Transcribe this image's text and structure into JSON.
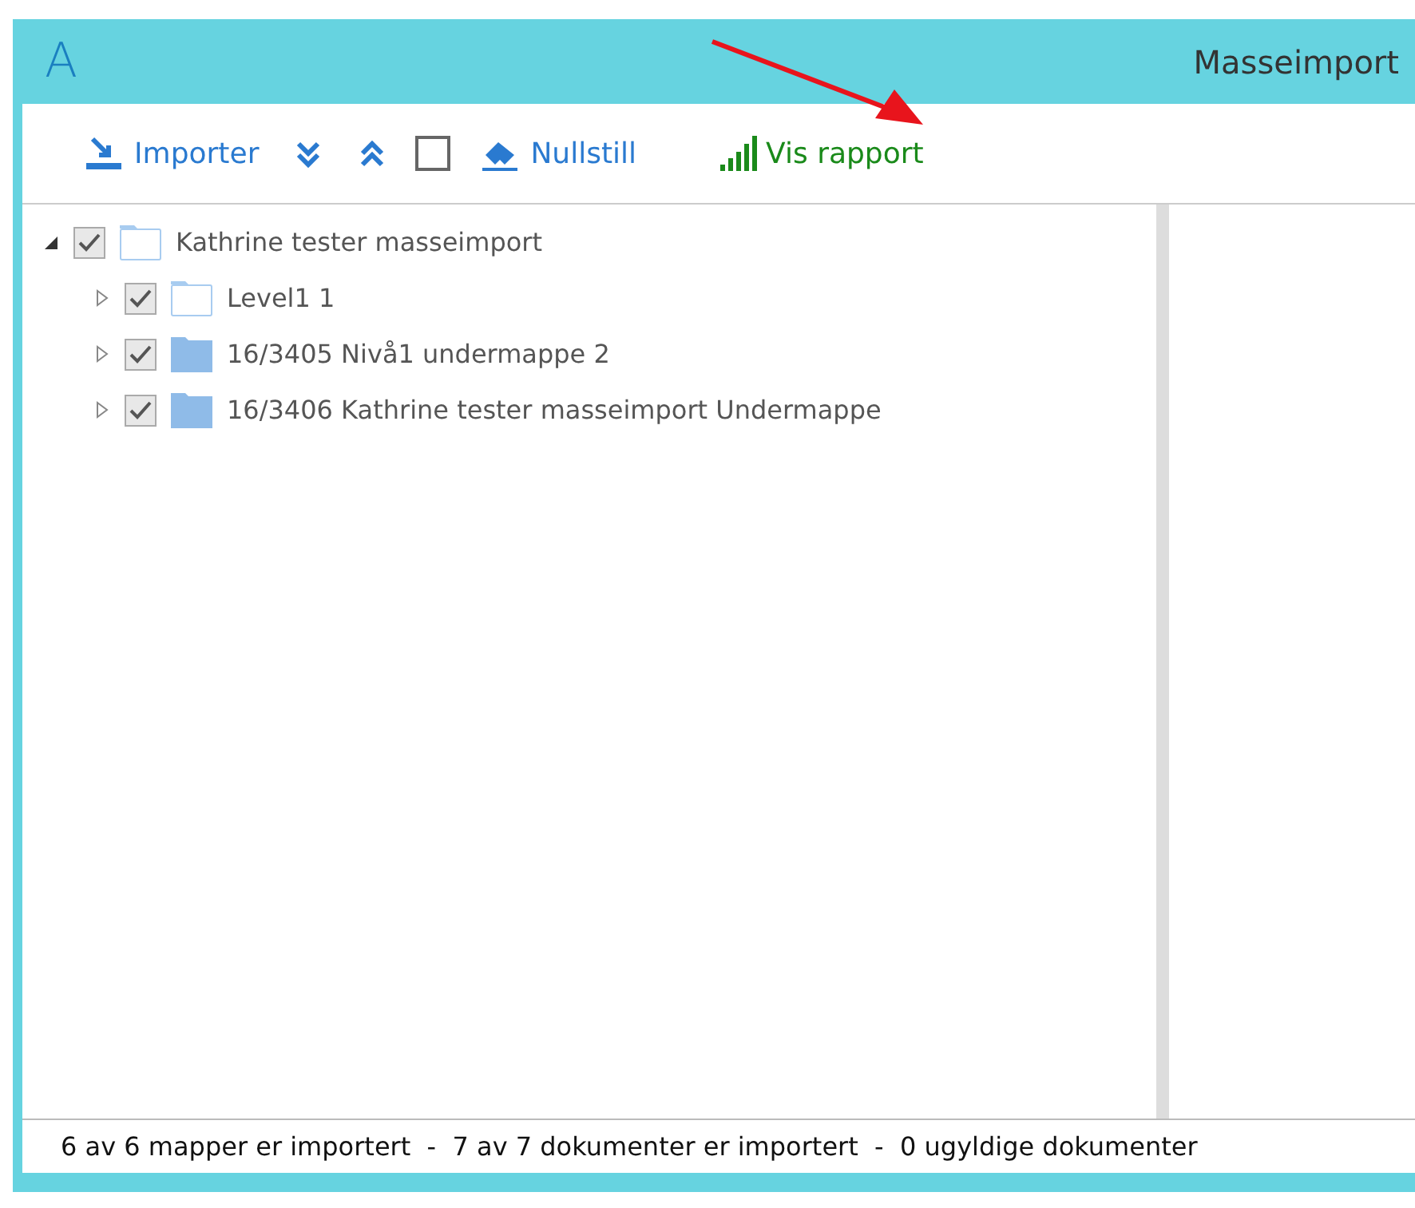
{
  "window": {
    "title": "Masseimport",
    "logo": "A"
  },
  "toolbar": [
    {
      "kind": "import",
      "label": "Importer"
    },
    {
      "kind": "expand-all"
    },
    {
      "kind": "collapse-all"
    },
    {
      "kind": "checkbox",
      "checked": false
    },
    {
      "kind": "reset",
      "label": "Nullstill"
    },
    {
      "kind": "report",
      "label": "Vis rapport"
    }
  ],
  "tree": [
    {
      "label": "Kathrine tester masseimport",
      "expanded": true,
      "checked": true,
      "kind": "outline",
      "children": [
        {
          "label": "Level1 1",
          "expanded": false,
          "checked": true,
          "kind": "outline"
        },
        {
          "label": "16/3405 Nivå1 undermappe 2",
          "expanded": false,
          "checked": true,
          "kind": "filled"
        },
        {
          "label": "16/3406 Kathrine tester masseimport Undermappe",
          "expanded": false,
          "checked": true,
          "kind": "filled"
        }
      ]
    }
  ],
  "status_bar": "6 av 6 mapper er importert  -  7 av 7 dokumenter er importert  -  0 ugyldige dokumenter"
}
